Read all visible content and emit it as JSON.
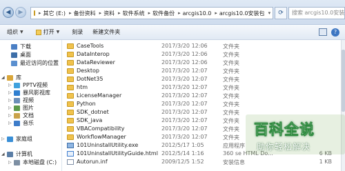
{
  "address_bar": {
    "crumbs": [
      "其它 (E:)",
      "备份资料",
      "资料",
      "软件系统",
      "软件备份",
      "arcgis10.0",
      "arcgis10.0安装包"
    ],
    "search_placeholder": "搜索 arcgis10.0安装包"
  },
  "toolbar": {
    "organize_label": "组织",
    "open_label": "打开",
    "burn_label": "刻录",
    "new_folder_label": "新建文件夹"
  },
  "sidebar": {
    "items": [
      {
        "label": "下载",
        "icon": "download-folder-icon",
        "color": "#4a7fc4"
      },
      {
        "label": "桌面",
        "icon": "desktop-icon",
        "color": "#3d6ea8"
      },
      {
        "label": "最近访问的位置",
        "icon": "recent-places-icon",
        "color": "#5a8fcf"
      },
      {
        "label": "库",
        "icon": "libraries-icon",
        "color": "#d9a63a"
      },
      {
        "label": "PPTV视频",
        "icon": "pptv-video-icon",
        "color": "#3fa1dd"
      },
      {
        "label": "暴风影视库",
        "icon": "baofeng-icon",
        "color": "#2f7fd0"
      },
      {
        "label": "视频",
        "icon": "videos-icon",
        "color": "#6b8fb8"
      },
      {
        "label": "图片",
        "icon": "pictures-icon",
        "color": "#5c9a4a"
      },
      {
        "label": "文档",
        "icon": "documents-icon",
        "color": "#c9a24a"
      },
      {
        "label": "音乐",
        "icon": "music-icon",
        "color": "#3d7cc9"
      },
      {
        "label": "家庭组",
        "icon": "homegroup-icon",
        "color": "#3a8fd6"
      },
      {
        "label": "计算机",
        "icon": "computer-icon",
        "color": "#5b7ea6"
      },
      {
        "label": "本地磁盘 (C:)",
        "icon": "local-disk-icon",
        "color": "#7d8fa3"
      }
    ]
  },
  "files": [
    {
      "name": "CaseTools",
      "date": "2017/3/20 12:06",
      "type": "文件夹",
      "size": "",
      "icon": "folder-icon"
    },
    {
      "name": "DataInterop",
      "date": "2017/3/20 12:06",
      "type": "文件夹",
      "size": "",
      "icon": "folder-icon"
    },
    {
      "name": "DataReviewer",
      "date": "2017/3/20 12:06",
      "type": "文件夹",
      "size": "",
      "icon": "folder-icon"
    },
    {
      "name": "Desktop",
      "date": "2017/3/20 12:07",
      "type": "文件夹",
      "size": "",
      "icon": "folder-icon"
    },
    {
      "name": "DotNet35",
      "date": "2017/3/20 12:07",
      "type": "文件夹",
      "size": "",
      "icon": "folder-icon"
    },
    {
      "name": "htm",
      "date": "2017/3/20 12:07",
      "type": "文件夹",
      "size": "",
      "icon": "folder-icon"
    },
    {
      "name": "LicenseManager",
      "date": "2017/3/20 12:07",
      "type": "文件夹",
      "size": "",
      "icon": "folder-icon"
    },
    {
      "name": "Python",
      "date": "2017/3/20 12:07",
      "type": "文件夹",
      "size": "",
      "icon": "folder-icon"
    },
    {
      "name": "SDK_dotnet",
      "date": "2017/3/20 12:07",
      "type": "文件夹",
      "size": "",
      "icon": "folder-icon"
    },
    {
      "name": "SDK_java",
      "date": "2017/3/20 12:07",
      "type": "文件夹",
      "size": "",
      "icon": "folder-icon"
    },
    {
      "name": "VBACompatibility",
      "date": "2017/3/20 12:07",
      "type": "文件夹",
      "size": "",
      "icon": "folder-icon"
    },
    {
      "name": "WorkflowManager",
      "date": "2017/3/20 12:07",
      "type": "文件夹",
      "size": "",
      "icon": "folder-icon"
    },
    {
      "name": "101UninstallUtility.exe",
      "date": "2012/5/17 1:05",
      "type": "应用程序",
      "size": "",
      "icon": "exe-icon"
    },
    {
      "name": "101UninstallUtilityGuide.html",
      "date": "2012/5/14 1:16",
      "type": "360 se HTML Do...",
      "size": "6 KB",
      "icon": "html-icon"
    },
    {
      "name": "Autorun.inf",
      "date": "2009/12/5 1:52",
      "type": "安装信息",
      "size": "1 KB",
      "icon": "inf-icon"
    }
  ],
  "watermark": {
    "logo_text": "百科全说",
    "sub_text": "助你轻松解决"
  }
}
